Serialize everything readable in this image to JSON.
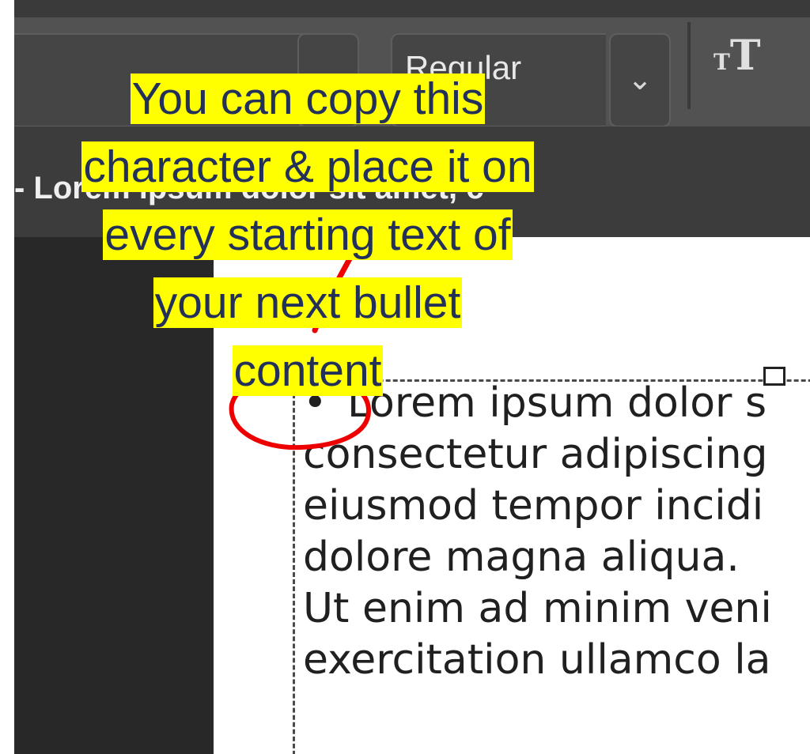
{
  "options_bar": {
    "font_style_value": "Regular",
    "dropdown_icon": "chevron-down-icon",
    "text_size_icon": "text-size-icon",
    "text_size_glyph_small": "T",
    "text_size_glyph_large": "T"
  },
  "document_tab": {
    "label": "- Lorem ipsum dolor sit amet, c"
  },
  "document": {
    "bullet": "•",
    "lines": [
      "Lorem ipsum dolor s",
      "consectetur adipiscing",
      "eiusmod tempor incidi",
      "dolore magna aliqua.",
      "Ut enim ad minim veni",
      "exercitation ullamco la"
    ]
  },
  "annotation": {
    "callout_lines": [
      "You can copy this",
      "character & place it on",
      "every starting text of",
      "your next bullet",
      "content"
    ],
    "highlight_color": "#ffff00",
    "text_color": "#23315a",
    "circle_color": "#ee0000"
  }
}
